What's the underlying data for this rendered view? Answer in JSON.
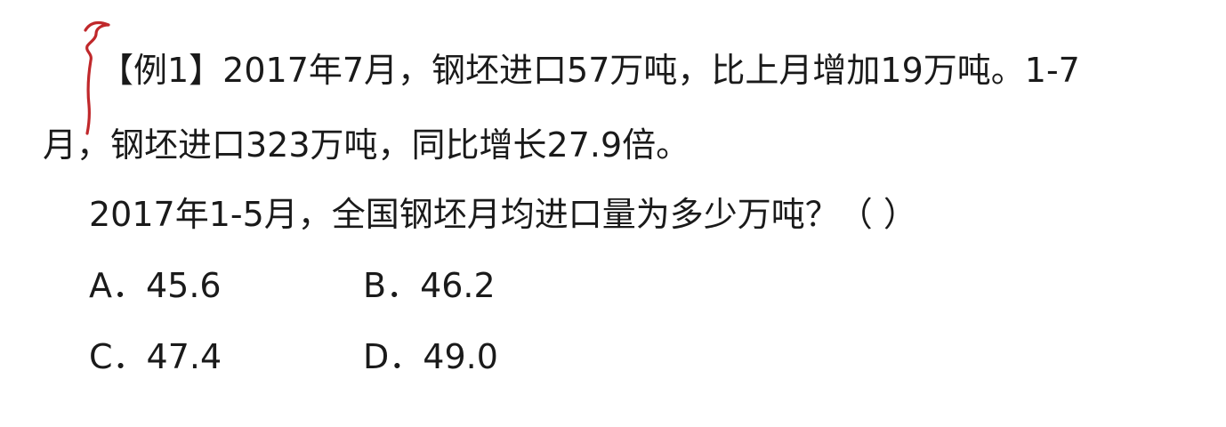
{
  "annotation": {
    "mark_icon": "handwritten-red-bracket-icon",
    "color": "#c0282b"
  },
  "question": {
    "stem_line1": "【例1】2017年7月，钢坯进口57万吨，比上月增加19万吨。1-7",
    "stem_line2": "月，钢坯进口323万吨，同比增长27.9倍。",
    "prompt": "2017年1-5月，全国钢坯月均进口量为多少万吨？（    ）",
    "options": [
      {
        "text": "A．45.6"
      },
      {
        "text": "B．46.2"
      },
      {
        "text": "C．47.4"
      },
      {
        "text": "D．49.0"
      }
    ]
  }
}
